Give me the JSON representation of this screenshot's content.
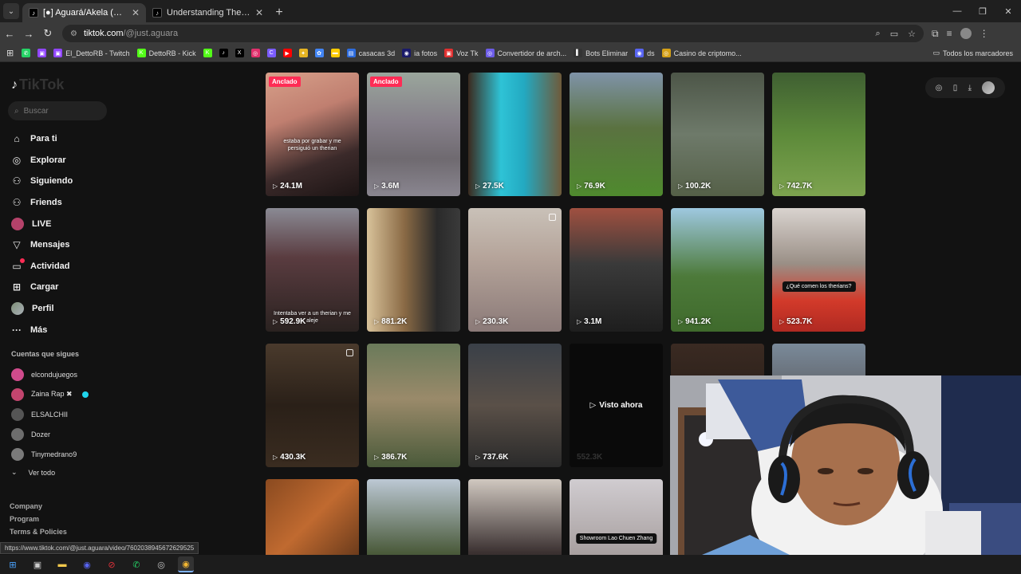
{
  "browser": {
    "tabs": [
      {
        "title": "[●] Aguará/Akela (@just.agu",
        "active": true
      },
      {
        "title": "Understanding Therians and Th",
        "active": false
      }
    ],
    "url_host": "tiktok.com",
    "url_path": "/@just.aguara",
    "bookmarks": [
      {
        "label": "",
        "color": "#25d366",
        "glyph": "✆"
      },
      {
        "label": "",
        "color": "#9146ff",
        "glyph": "▣"
      },
      {
        "label": "El_DettoRB - Twitch",
        "color": "#9146ff",
        "glyph": "▣"
      },
      {
        "label": "DettoRB - Kick",
        "color": "#53fc18",
        "glyph": "K"
      },
      {
        "label": "",
        "color": "#53fc18",
        "glyph": "K"
      },
      {
        "label": "",
        "color": "#000000",
        "glyph": "♪"
      },
      {
        "label": "",
        "color": "#000000",
        "glyph": "X"
      },
      {
        "label": "",
        "color": "#e1306c",
        "glyph": "◎"
      },
      {
        "label": "",
        "color": "#7b5cff",
        "glyph": "C"
      },
      {
        "label": "",
        "color": "#ff0000",
        "glyph": "▶"
      },
      {
        "label": "",
        "color": "#e6b422",
        "glyph": "✦"
      },
      {
        "label": "",
        "color": "#4285f4",
        "glyph": "✿"
      },
      {
        "label": "",
        "color": "#ffcc00",
        "glyph": "▬"
      },
      {
        "label": "casacas 3d",
        "color": "#2d6cdf",
        "glyph": "▤"
      },
      {
        "label": "ia fotos",
        "color": "#1a1a6a",
        "glyph": "◉"
      },
      {
        "label": "Voz Tk",
        "color": "#e03030",
        "glyph": "▣"
      },
      {
        "label": "Convertidor de arch...",
        "color": "#6c5ce7",
        "glyph": "◎"
      },
      {
        "label": "Bots Eliminar",
        "color": "#333333",
        "glyph": "▌"
      },
      {
        "label": "ds",
        "color": "#5865f2",
        "glyph": "◉"
      },
      {
        "label": "Casino de criptomo...",
        "color": "#d4a017",
        "glyph": "◎"
      }
    ],
    "bookmarks_all": "Todos los marcadores"
  },
  "sidebar": {
    "logo": "TikTok",
    "search_placeholder": "Buscar",
    "nav": [
      {
        "label": "Para ti",
        "icon": "home-icon",
        "glyph": "⌂"
      },
      {
        "label": "Explorar",
        "icon": "compass-icon",
        "glyph": "◎"
      },
      {
        "label": "Siguiendo",
        "icon": "following-icon",
        "glyph": "⚇"
      },
      {
        "label": "Friends",
        "icon": "friends-icon",
        "glyph": "⚇"
      },
      {
        "label": "LIVE",
        "icon": "live-icon",
        "glyph": ""
      },
      {
        "label": "Mensajes",
        "icon": "messages-icon",
        "glyph": "▽"
      },
      {
        "label": "Actividad",
        "icon": "activity-icon",
        "glyph": "▭"
      },
      {
        "label": "Cargar",
        "icon": "upload-icon",
        "glyph": "⊞"
      },
      {
        "label": "Perfil",
        "icon": "profile-icon",
        "glyph": ""
      },
      {
        "label": "Más",
        "icon": "more-icon",
        "glyph": "···"
      }
    ],
    "following_title": "Cuentas que sigues",
    "following": [
      {
        "name": "elcondujuegos",
        "color": "#d04b8c"
      },
      {
        "name": "Zaina Rap ✖",
        "color": "#c2456e",
        "verified": true
      },
      {
        "name": "ELSALCHII",
        "color": "#555555"
      },
      {
        "name": "Dozer",
        "color": "#6d6d6d"
      },
      {
        "name": "Tinymedrano9",
        "color": "#7a7a7a"
      }
    ],
    "see_all": "Ver todo",
    "footer": [
      "Company",
      "Program",
      "Terms & Policies"
    ]
  },
  "videos": [
    {
      "views": "24.1M",
      "pinned": "Anclado",
      "caption": "estaba por grabar y me persiguió un therian",
      "bg": "linear-gradient(160deg,#d7a08a 0%,#c07f70 35%,#3b2a2a 70%,#1c1414 100%)"
    },
    {
      "views": "3.6M",
      "pinned": "Anclado",
      "bg": "linear-gradient(180deg,#9aa69c 0%,#86808a 40%,#6f6a70 70%,#8a8690 100%)"
    },
    {
      "views": "27.5K",
      "bg": "linear-gradient(90deg,#3b2b1f 0%,#2ec3d6 35%,#23a9c1 60%,#6f5a3a 100%)"
    },
    {
      "views": "76.9K",
      "bg": "linear-gradient(180deg,#7f93a8 0%,#5a7240 45%,#4f8a2e 100%)"
    },
    {
      "views": "100.2K",
      "bg": "linear-gradient(180deg,#4d5648 0%,#6e7a6a 50%,#556048 100%)"
    },
    {
      "views": "742.7K",
      "bg": "linear-gradient(180deg,#3f5f32 0%,#5d8a3a 50%,#7da34f 100%)"
    },
    {
      "views": "592.9K",
      "caption_low": "Intentaba ver a un therian y me aleje",
      "bg": "linear-gradient(180deg,#8a8a94 0%,#5a3c40 40%,#2a2220 100%)"
    },
    {
      "views": "881.2K",
      "bg": "linear-gradient(90deg,#d8c29a 0%,#8a6a45 40%,#2a2a2a 75%,#3a3a3a 100%)"
    },
    {
      "views": "230.3K",
      "multi": true,
      "bg": "linear-gradient(180deg,#c9c1b8 0%,#b5a49a 40%,#8b7a78 100%)"
    },
    {
      "views": "3.1M",
      "bg": "linear-gradient(180deg,#a05040 0%,#3a3a3a 45%,#1e1e1e 100%)"
    },
    {
      "views": "941.2K",
      "bg": "linear-gradient(180deg,#9ec8e0 0%,#4d7a3a 55%,#3f6a2c 100%)"
    },
    {
      "views": "523.7K",
      "label": "¿Qué comen los therians?",
      "bg": "linear-gradient(180deg,#d9d3cf 0%,#9a8f86 45%,#d23a2a 75%,#b02a22 100%)"
    },
    {
      "views": "430.3K",
      "multi": true,
      "bg": "linear-gradient(180deg,#4a3a2c 0%,#2a2018 50%,#3a2c20 100%)"
    },
    {
      "views": "386.7K",
      "bg": "linear-gradient(180deg,#6a7a5a 0%,#9a8a6a 45%,#4a5a3a 100%)"
    },
    {
      "views": "737.6K",
      "bg": "linear-gradient(180deg,#3a4048 0%,#5a5048 50%,#2a2a2a 100%)"
    },
    {
      "views": "552.3K",
      "watched": "Visto ahora",
      "bg": "#0e0e0e"
    },
    {
      "views": "",
      "bg": "linear-gradient(180deg,#3a2a22 0%,#1a1410 100%)"
    },
    {
      "views": "",
      "bg": "linear-gradient(180deg,#7a8a9a 0%,#3a2a22 100%)"
    },
    {
      "views": "",
      "bg": "linear-gradient(135deg,#8a4a20 0%,#c06a30 40%,#3a2010 100%)"
    },
    {
      "views": "",
      "bg": "linear-gradient(180deg,#bcc8d4 0%,#4a5a3a 60%,#2a2a2a 100%)"
    },
    {
      "views": "",
      "bg": "linear-gradient(180deg,#d0c8c0 0%,#3a3030 60%,#1a1a1a 100%)"
    },
    {
      "views": "",
      "label": "Showroom Lao Chuen Zhang",
      "bg": "linear-gradient(180deg,#d0ccd0 0%,#a8a0a0 60%,#8a8080 100%)"
    }
  ],
  "status_url": "https://www.tiktok.com/@just.aguara/video/7602038945672629525",
  "taskbar": [
    {
      "name": "windows-start-icon",
      "glyph": "⊞",
      "color": "#4aa3ff"
    },
    {
      "name": "task-view-icon",
      "glyph": "▣",
      "color": "#cccccc"
    },
    {
      "name": "file-explorer-icon",
      "glyph": "▬",
      "color": "#f2c94c"
    },
    {
      "name": "discord-icon",
      "glyph": "◉",
      "color": "#5865f2"
    },
    {
      "name": "opera-icon",
      "glyph": "⊘",
      "color": "#e0313b"
    },
    {
      "name": "whatsapp-icon",
      "glyph": "✆",
      "color": "#25d366"
    },
    {
      "name": "obs-icon",
      "glyph": "◎",
      "color": "#c8c8c8"
    },
    {
      "name": "chrome-icon",
      "glyph": "◉",
      "color": "#f2b632",
      "active": true
    }
  ]
}
